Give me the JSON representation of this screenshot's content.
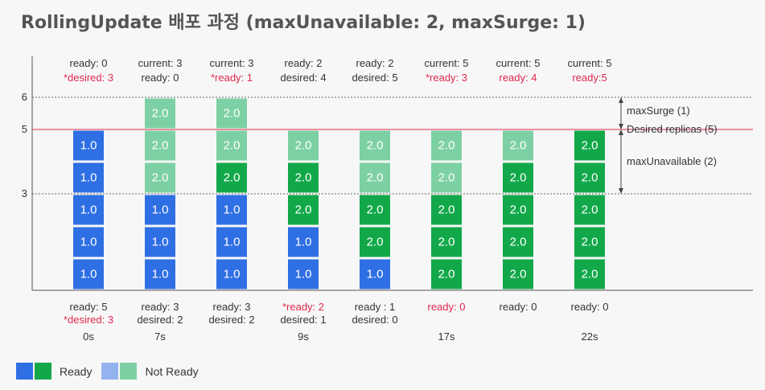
{
  "title": "RollingUpdate 배포 과정 (maxUnavailable: 2, maxSurge: 1)",
  "colors": {
    "v1_ready": "#2f6fe4",
    "v2_ready": "#12a84a",
    "v1_not_ready": "#93b3ee",
    "v2_not_ready": "#7dd0a3",
    "desired_line": "#e0284f",
    "text_red": "#e0284f"
  },
  "chart_data": {
    "type": "stacked-columns",
    "y_ticks": [
      6,
      5,
      3
    ],
    "reference_lines": [
      {
        "value": 6,
        "style": "dotted"
      },
      {
        "value": 5,
        "style": "solid-red"
      },
      {
        "value": 3,
        "style": "dotted"
      }
    ],
    "annotations": [
      {
        "text": "maxSurge (1)",
        "from": 5,
        "to": 6
      },
      {
        "text": "Desired replicas (5)",
        "at": 5
      },
      {
        "text": "maxUnavailable (2)",
        "from": 3,
        "to": 5
      }
    ],
    "columns": [
      {
        "top": [
          {
            "text": "ready: 0",
            "red": false
          },
          {
            "text": "*desired: 3",
            "red": true
          }
        ],
        "bottom": [
          {
            "text": "ready: 5",
            "red": false
          },
          {
            "text": "*desired: 3",
            "red": true
          }
        ],
        "time": "0s",
        "cells": [
          {
            "label": "1.0",
            "version": 1,
            "ready": true
          },
          {
            "label": "1.0",
            "version": 1,
            "ready": true
          },
          {
            "label": "1.0",
            "version": 1,
            "ready": true
          },
          {
            "label": "1.0",
            "version": 1,
            "ready": true
          },
          {
            "label": "1.0",
            "version": 1,
            "ready": true
          }
        ]
      },
      {
        "top": [
          {
            "text": "current: 3",
            "red": false
          },
          {
            "text": "ready: 0",
            "red": false
          }
        ],
        "bottom": [
          {
            "text": "ready: 3",
            "red": false
          },
          {
            "text": "desired: 2",
            "red": false
          }
        ],
        "time": "7s",
        "cells": [
          {
            "label": "1.0",
            "version": 1,
            "ready": true
          },
          {
            "label": "1.0",
            "version": 1,
            "ready": true
          },
          {
            "label": "1.0",
            "version": 1,
            "ready": true
          },
          {
            "label": "2.0",
            "version": 2,
            "ready": false
          },
          {
            "label": "2.0",
            "version": 2,
            "ready": false
          },
          {
            "label": "2.0",
            "version": 2,
            "ready": false
          }
        ]
      },
      {
        "top": [
          {
            "text": "current: 3",
            "red": false
          },
          {
            "text": "*ready: 1",
            "red": true
          }
        ],
        "bottom": [
          {
            "text": "ready: 3",
            "red": false
          },
          {
            "text": "desired: 2",
            "red": false
          }
        ],
        "time": "",
        "cells": [
          {
            "label": "1.0",
            "version": 1,
            "ready": true
          },
          {
            "label": "1.0",
            "version": 1,
            "ready": true
          },
          {
            "label": "1.0",
            "version": 1,
            "ready": true
          },
          {
            "label": "2.0",
            "version": 2,
            "ready": true
          },
          {
            "label": "2.0",
            "version": 2,
            "ready": false
          },
          {
            "label": "2.0",
            "version": 2,
            "ready": false
          }
        ]
      },
      {
        "top": [
          {
            "text": "ready: 2",
            "red": false
          },
          {
            "text": "desired: 4",
            "red": false
          }
        ],
        "bottom": [
          {
            "text": "*ready: 2",
            "red": true
          },
          {
            "text": "desired: 1",
            "red": false
          }
        ],
        "time": "9s",
        "cells": [
          {
            "label": "1.0",
            "version": 1,
            "ready": true
          },
          {
            "label": "1.0",
            "version": 1,
            "ready": true
          },
          {
            "label": "2.0",
            "version": 2,
            "ready": true
          },
          {
            "label": "2.0",
            "version": 2,
            "ready": true
          },
          {
            "label": "2.0",
            "version": 2,
            "ready": false
          }
        ]
      },
      {
        "top": [
          {
            "text": "ready: 2",
            "red": false
          },
          {
            "text": "desired: 5",
            "red": false
          }
        ],
        "bottom": [
          {
            "text": "ready : 1",
            "red": false
          },
          {
            "text": "desired: 0",
            "red": false
          }
        ],
        "time": "",
        "cells": [
          {
            "label": "1.0",
            "version": 1,
            "ready": true
          },
          {
            "label": "2.0",
            "version": 2,
            "ready": true
          },
          {
            "label": "2.0",
            "version": 2,
            "ready": true
          },
          {
            "label": "2.0",
            "version": 2,
            "ready": false
          },
          {
            "label": "2.0",
            "version": 2,
            "ready": false
          }
        ]
      },
      {
        "top": [
          {
            "text": "current: 5",
            "red": false
          },
          {
            "text": "*ready: 3",
            "red": true
          }
        ],
        "bottom": [
          {
            "text": "ready: 0",
            "red": true
          }
        ],
        "time": "17s",
        "cells": [
          {
            "label": "2.0",
            "version": 2,
            "ready": true
          },
          {
            "label": "2.0",
            "version": 2,
            "ready": true
          },
          {
            "label": "2.0",
            "version": 2,
            "ready": true
          },
          {
            "label": "2.0",
            "version": 2,
            "ready": false
          },
          {
            "label": "2.0",
            "version": 2,
            "ready": false
          }
        ]
      },
      {
        "top": [
          {
            "text": "current: 5",
            "red": false
          },
          {
            "text": "ready: 4",
            "red": true
          }
        ],
        "bottom": [
          {
            "text": "ready: 0",
            "red": false
          }
        ],
        "time": "",
        "cells": [
          {
            "label": "2.0",
            "version": 2,
            "ready": true
          },
          {
            "label": "2.0",
            "version": 2,
            "ready": true
          },
          {
            "label": "2.0",
            "version": 2,
            "ready": true
          },
          {
            "label": "2.0",
            "version": 2,
            "ready": true
          },
          {
            "label": "2.0",
            "version": 2,
            "ready": false
          }
        ]
      },
      {
        "top": [
          {
            "text": "current: 5",
            "red": false
          },
          {
            "text": "ready:5",
            "red": true
          }
        ],
        "bottom": [
          {
            "text": "ready: 0",
            "red": false
          }
        ],
        "time": "22s",
        "cells": [
          {
            "label": "2.0",
            "version": 2,
            "ready": true
          },
          {
            "label": "2.0",
            "version": 2,
            "ready": true
          },
          {
            "label": "2.0",
            "version": 2,
            "ready": true
          },
          {
            "label": "2.0",
            "version": 2,
            "ready": true
          },
          {
            "label": "2.0",
            "version": 2,
            "ready": true
          }
        ]
      }
    ]
  },
  "legend": {
    "ready_label": "Ready",
    "not_ready_label": "Not Ready"
  }
}
